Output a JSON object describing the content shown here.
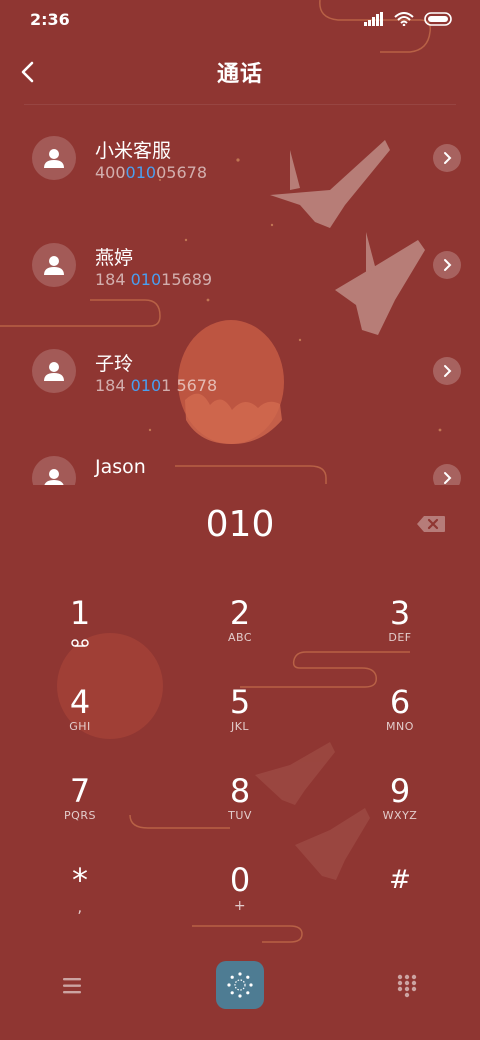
{
  "status_bar": {
    "time": "2:36"
  },
  "header": {
    "title": "通话"
  },
  "contacts": [
    {
      "name": "小米客服",
      "number_pre": "400",
      "number_match": "010",
      "number_post": "05678"
    },
    {
      "name": "燕婷",
      "number_pre": "184 ",
      "number_match": "010",
      "number_post": "15689"
    },
    {
      "name": "子玲",
      "number_pre": "184 ",
      "number_match": "010",
      "number_post": "1 5678"
    },
    {
      "name": "Jason",
      "number_pre": "",
      "number_match": "",
      "number_post": ""
    }
  ],
  "dialer": {
    "number": "010"
  },
  "keypad": {
    "keys": [
      {
        "digit": "1",
        "letters": ""
      },
      {
        "digit": "2",
        "letters": "ABC"
      },
      {
        "digit": "3",
        "letters": "DEF"
      },
      {
        "digit": "4",
        "letters": "GHI"
      },
      {
        "digit": "5",
        "letters": "JKL"
      },
      {
        "digit": "6",
        "letters": "MNO"
      },
      {
        "digit": "7",
        "letters": "PQRS"
      },
      {
        "digit": "8",
        "letters": "TUV"
      },
      {
        "digit": "9",
        "letters": "WXYZ"
      },
      {
        "digit": "*",
        "letters": ","
      },
      {
        "digit": "0",
        "letters": "+"
      },
      {
        "digit": "#",
        "letters": ""
      }
    ]
  },
  "icons": {
    "back": "chevron-left-icon",
    "voicemail": "voicemail-icon",
    "backspace": "backspace-icon",
    "menu": "menu-icon",
    "dial": "dial-icon",
    "keypad": "keypad-grid-icon"
  },
  "colors": {
    "background": "#8f3632",
    "highlight": "#4a9ff0",
    "dial_button": "#4e7c93"
  }
}
